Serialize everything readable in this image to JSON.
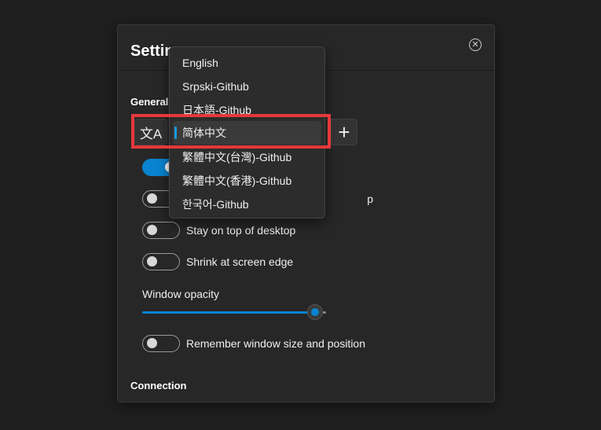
{
  "dialog": {
    "title": "Settings",
    "close_glyph": "✕",
    "close_icon": "close-circle-icon"
  },
  "sections": {
    "general": "General",
    "connection": "Connection"
  },
  "language": {
    "icon": "translate-icon",
    "icon_glyph": "文A",
    "add_glyph": "+",
    "options": [
      "English",
      "Srpski-Github",
      "日本語-Github",
      "简体中文",
      "繁體中文(台灣)-Github",
      "繁體中文(香港)-Github",
      "한국어-Github"
    ],
    "selected": "简体中文"
  },
  "toggles": [
    {
      "label": "",
      "on": true
    },
    {
      "label": "p",
      "on": false
    },
    {
      "label": "Stay on top of desktop",
      "on": false
    },
    {
      "label": "Shrink at screen edge",
      "on": false
    },
    {
      "label": "Remember window size and position",
      "on": false
    }
  ],
  "opacity": {
    "label": "Window opacity",
    "value_fraction": 0.94
  },
  "colors": {
    "accent": "#0a84d0",
    "highlight": "#e5383b"
  }
}
